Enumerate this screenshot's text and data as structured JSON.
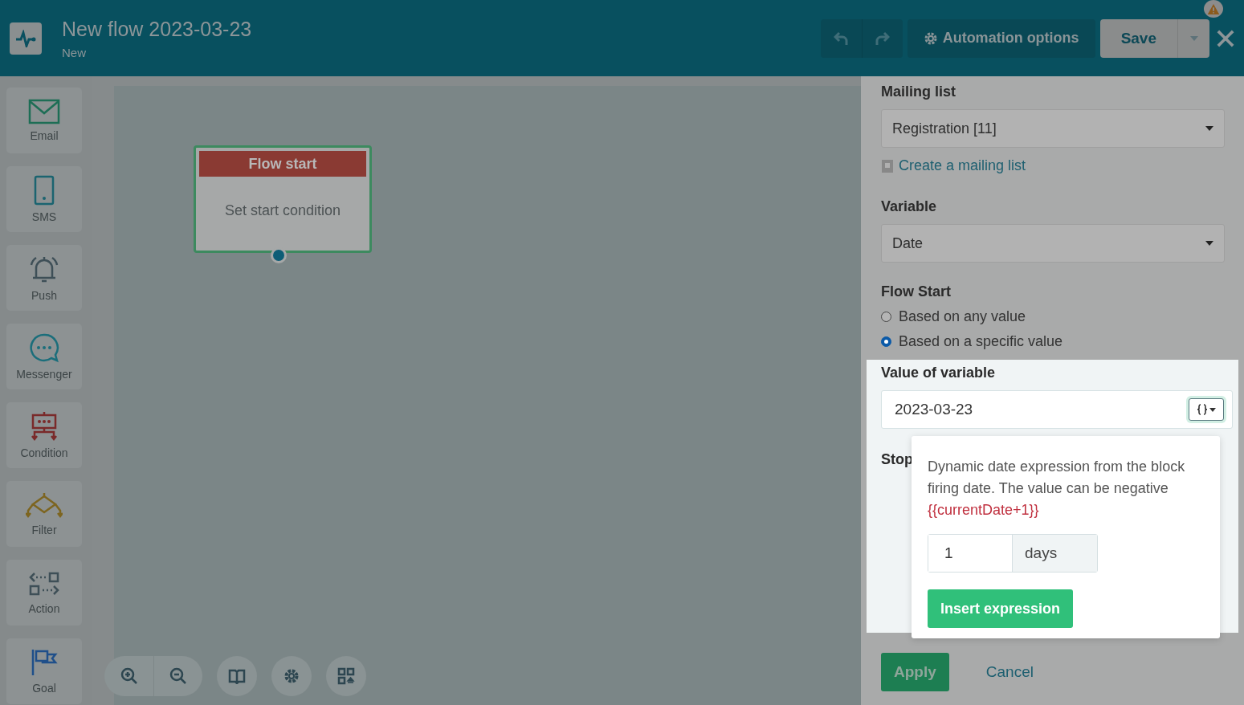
{
  "header": {
    "title": "New flow 2023-03-23",
    "status": "New",
    "options_button": "Automation options",
    "save_button": "Save"
  },
  "tools": [
    {
      "label": "Email",
      "kind": "email"
    },
    {
      "label": "SMS",
      "kind": "sms"
    },
    {
      "label": "Push",
      "kind": "push"
    },
    {
      "label": "Messenger",
      "kind": "messenger"
    },
    {
      "label": "Condition",
      "kind": "condition"
    },
    {
      "label": "Filter",
      "kind": "filter"
    },
    {
      "label": "Action",
      "kind": "action"
    },
    {
      "label": "Goal",
      "kind": "goal"
    }
  ],
  "canvas": {
    "node": {
      "title": "Flow start",
      "body": "Set start condition"
    }
  },
  "panel": {
    "mailing_list": {
      "label": "Mailing list",
      "value": "Registration [11]",
      "create_link": "Create a mailing list"
    },
    "variable": {
      "label": "Variable",
      "value": "Date"
    },
    "flow_start": {
      "label": "Flow Start",
      "options": [
        {
          "label": "Based on any value",
          "selected": false
        },
        {
          "label": "Based on a specific value",
          "selected": true
        }
      ]
    },
    "value_of_variable": {
      "label": "Value of variable",
      "value": "2023-03-23"
    },
    "stop_label": "Stop",
    "popover": {
      "description": "Dynamic date expression from the block firing date. The value can be negative",
      "example": "{{currentDate+1}}",
      "amount": "1",
      "unit": "days",
      "insert_button": "Insert expression"
    },
    "apply_button": "Apply",
    "cancel_link": "Cancel"
  }
}
